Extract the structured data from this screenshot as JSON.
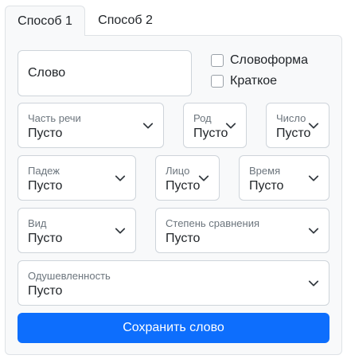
{
  "tabs": [
    {
      "label": "Способ 1",
      "active": true
    },
    {
      "label": "Способ 2",
      "active": false
    }
  ],
  "form": {
    "word": {
      "placeholder": "Слово",
      "value": ""
    },
    "checkboxes": [
      {
        "label": "Словоформа",
        "checked": false
      },
      {
        "label": "Краткое",
        "checked": false
      }
    ],
    "selects": {
      "part_of_speech": {
        "label": "Часть речи",
        "value": "Пусто"
      },
      "gender": {
        "label": "Род",
        "value": "Пусто"
      },
      "number": {
        "label": "Число",
        "value": "Пусто"
      },
      "case": {
        "label": "Падеж",
        "value": "Пусто"
      },
      "person": {
        "label": "Лицо",
        "value": "Пусто"
      },
      "tense": {
        "label": "Время",
        "value": "Пусто"
      },
      "aspect": {
        "label": "Вид",
        "value": "Пусто"
      },
      "degree": {
        "label": "Степень сравнения",
        "value": "Пусто"
      },
      "animacy": {
        "label": "Одушевленность",
        "value": "Пусто"
      }
    },
    "save_label": "Сохранить слово"
  },
  "colors": {
    "primary": "#0d6efd",
    "panel_bg": "#f8f9fa",
    "border": "#ced4da"
  }
}
